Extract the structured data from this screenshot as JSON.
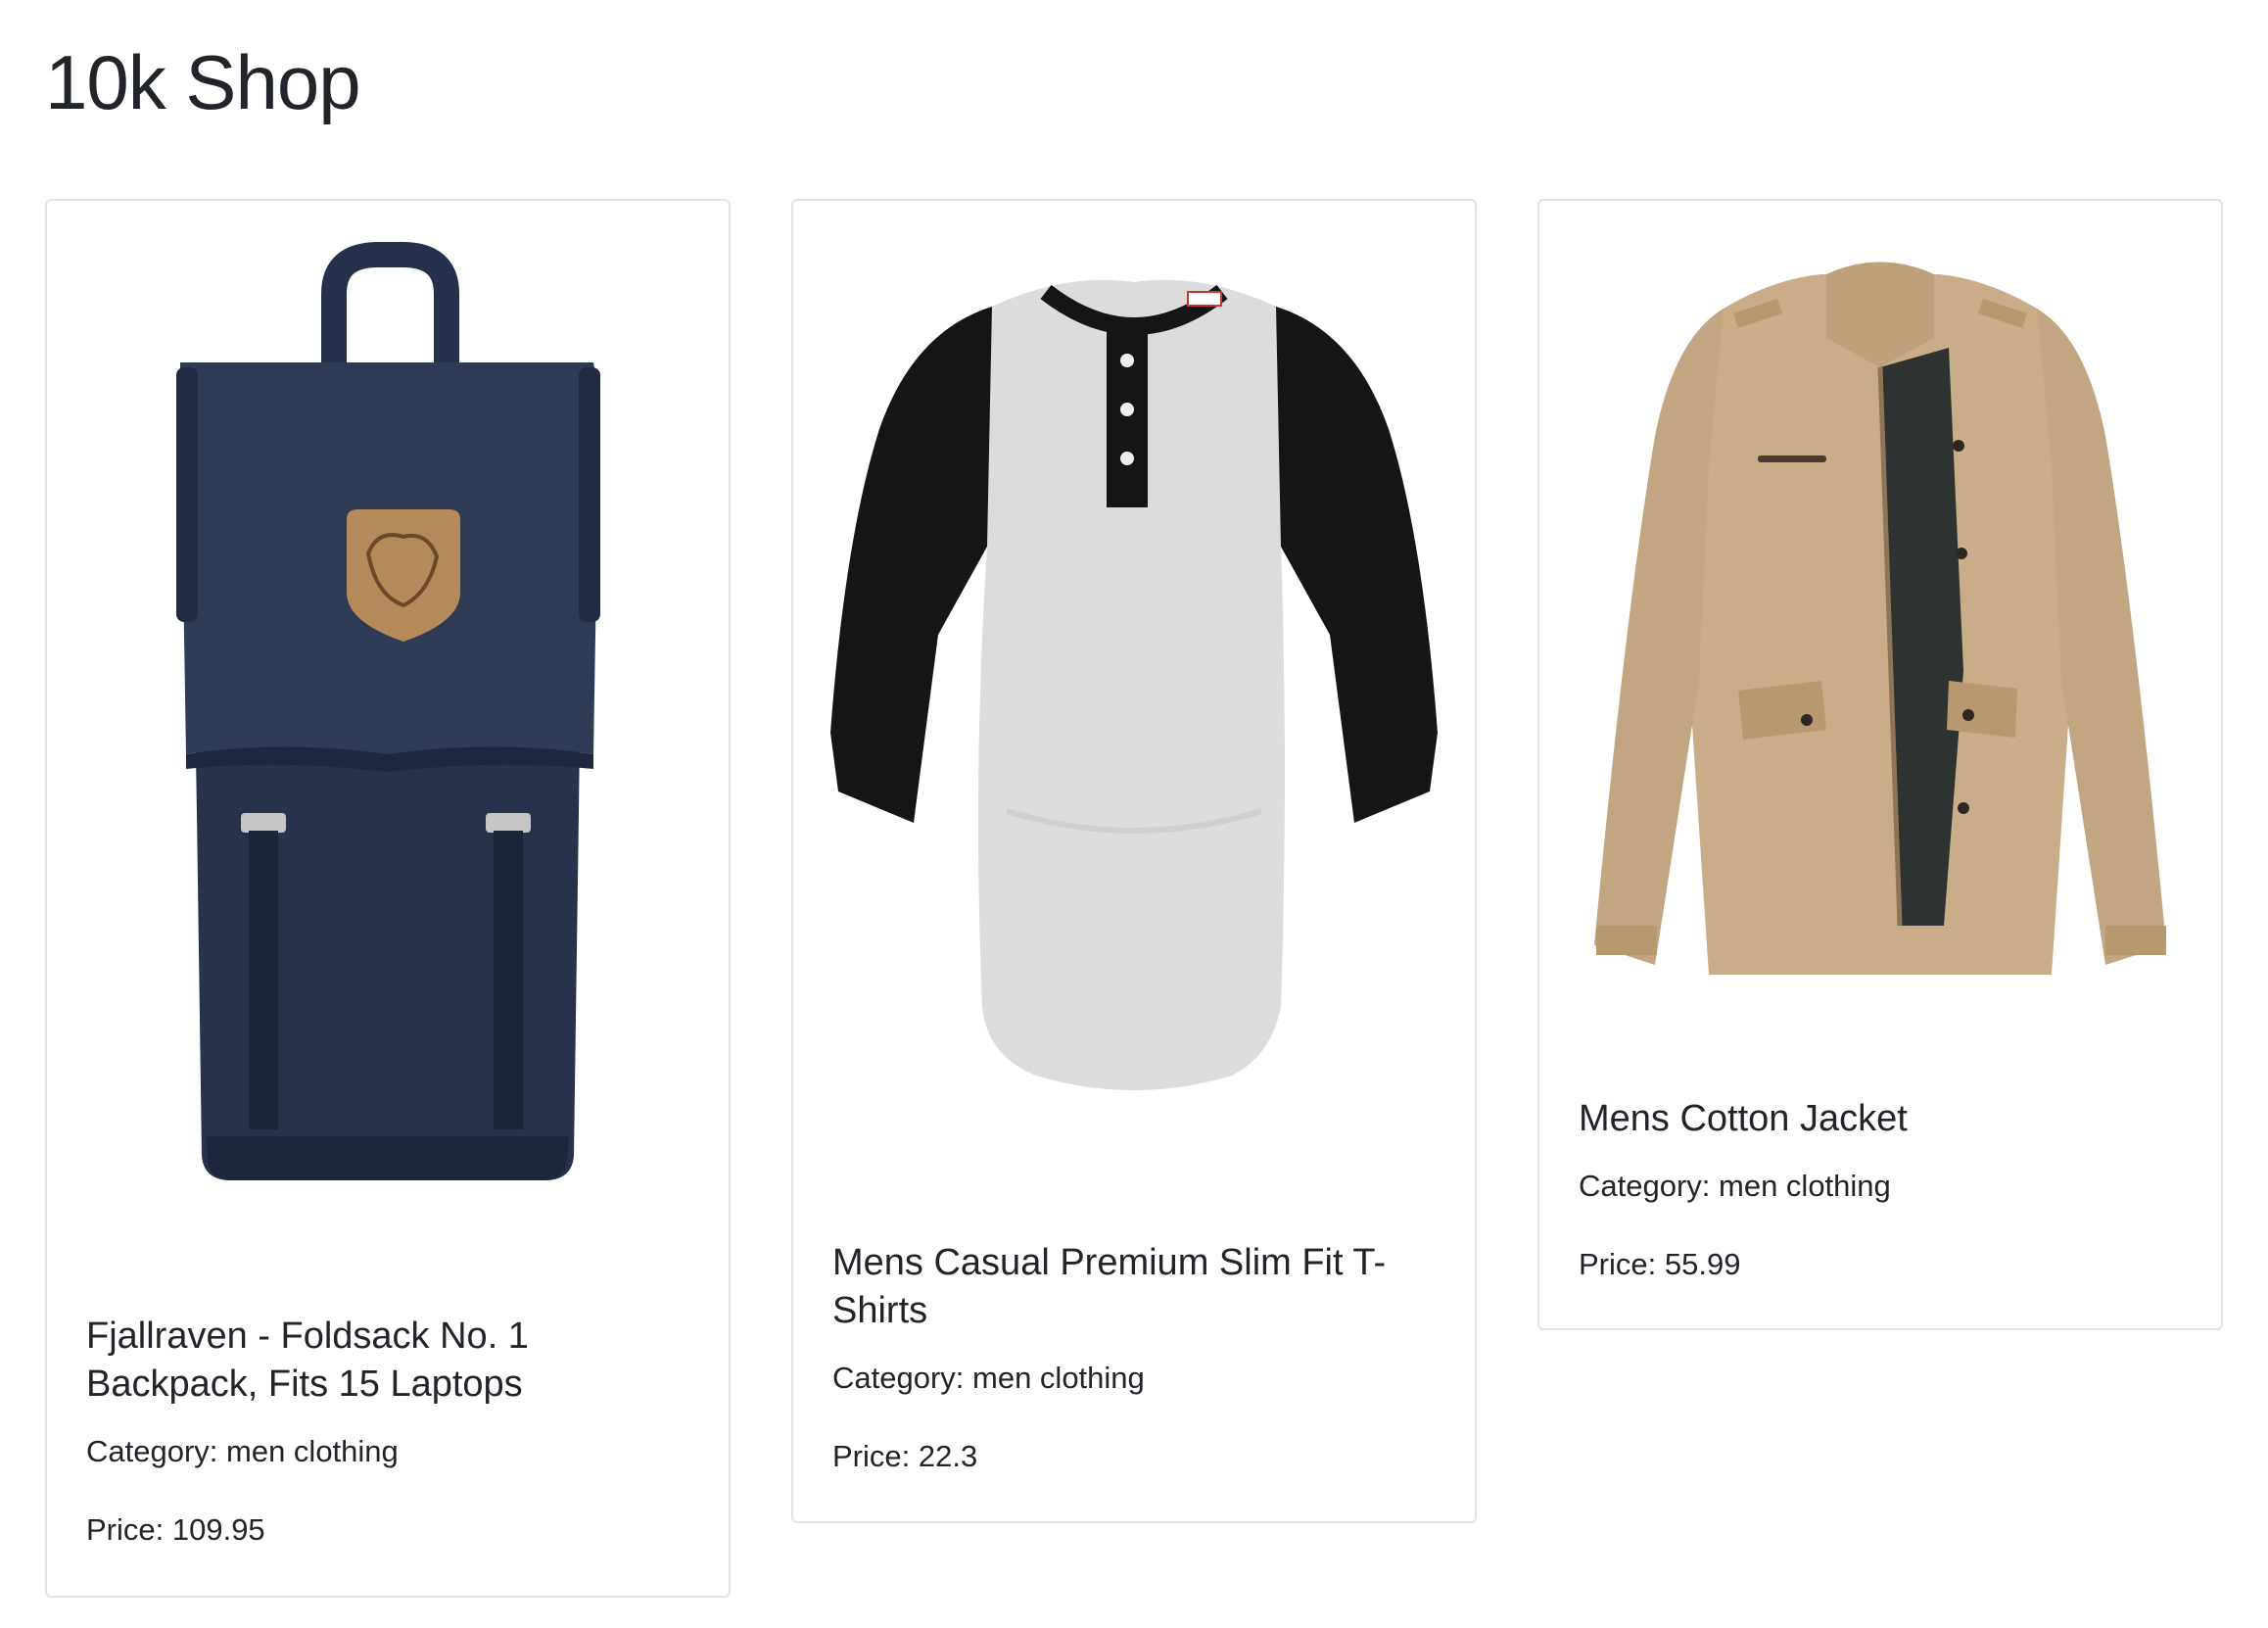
{
  "shop": {
    "title": "10k Shop"
  },
  "labels": {
    "category_prefix": "Category: ",
    "price_prefix": "Price: "
  },
  "products": [
    {
      "title": "Fjallraven - Foldsack No. 1 Backpack, Fits 15 Laptops",
      "category": "men clothing",
      "price": "109.95",
      "image_icon": "backpack-image",
      "colors": {
        "primary": "#27314a",
        "accent": "#b48a5a"
      }
    },
    {
      "title": "Mens Casual Premium Slim Fit T-Shirts",
      "category": "men clothing",
      "price": "22.3",
      "image_icon": "raglan-shirt-image",
      "colors": {
        "primary": "#d9d9d9",
        "accent": "#111111"
      }
    },
    {
      "title": "Mens Cotton Jacket",
      "category": "men clothing",
      "price": "55.99",
      "image_icon": "jacket-image",
      "colors": {
        "primary": "#c9ad89",
        "accent": "#2e3230"
      }
    }
  ]
}
